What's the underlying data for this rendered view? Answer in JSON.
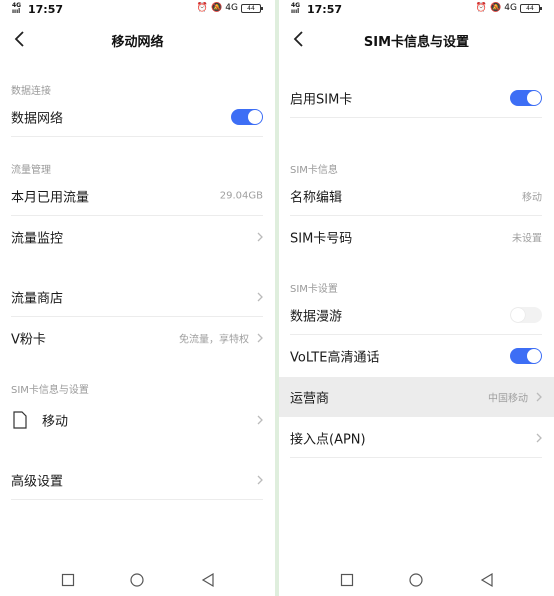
{
  "left": {
    "status": {
      "signal": "4G",
      "time": "17:57",
      "net": "4G",
      "battery": "44"
    },
    "title": "移动网络",
    "sections": {
      "data_connection": "数据连接",
      "traffic_management": "流量管理",
      "sim_info": "SIM卡信息与设置"
    },
    "rows": {
      "data_network": "数据网络",
      "monthly_usage": "本月已用流量",
      "monthly_usage_value": "29.04GB",
      "traffic_monitor": "流量监控",
      "traffic_store": "流量商店",
      "vcard": "V粉卡",
      "vcard_value": "免流量，享特权",
      "sim_carrier": "移动",
      "advanced": "高级设置"
    },
    "toggles": {
      "data_network": true
    }
  },
  "right": {
    "status": {
      "signal": "4G",
      "time": "17:57",
      "net": "4G",
      "battery": "44"
    },
    "title": "SIM卡信息与设置",
    "sections": {
      "sim_info": "SIM卡信息",
      "sim_settings": "SIM卡设置"
    },
    "rows": {
      "enable_sim": "启用SIM卡",
      "name_edit": "名称编辑",
      "name_edit_value": "移动",
      "sim_number": "SIM卡号码",
      "sim_number_value": "未设置",
      "roaming": "数据漫游",
      "volte": "VoLTE高清通话",
      "carrier": "运营商",
      "carrier_value": "中国移动",
      "apn": "接入点(APN)"
    },
    "toggles": {
      "enable_sim": true,
      "roaming": false,
      "volte": true
    }
  },
  "colors": {
    "accent": "#3d6ef5",
    "divider": "#dfeedd",
    "highlight": "#ececec"
  },
  "icons": {
    "back": "back-arrow-icon",
    "chevron": "chevron-right-icon",
    "sim": "sim-card-icon",
    "nav_recent": "square-icon",
    "nav_home": "circle-icon",
    "nav_back": "triangle-back-icon"
  }
}
